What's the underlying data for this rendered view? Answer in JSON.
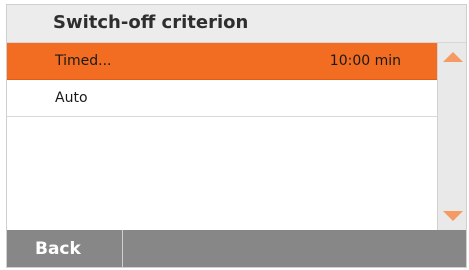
{
  "title": "Switch-off criterion",
  "list": {
    "items": [
      {
        "label": "Timed...",
        "value": "10:00 min",
        "selected": true
      },
      {
        "label": "Auto",
        "value": "",
        "selected": false
      }
    ]
  },
  "scrollbar": {
    "up_icon": "scroll-up-arrow",
    "down_icon": "scroll-down-arrow"
  },
  "footer": {
    "back_label": "Back"
  },
  "colors": {
    "accent": "#f26c21",
    "footer_bg": "#878787",
    "title_bg": "#ececec"
  }
}
